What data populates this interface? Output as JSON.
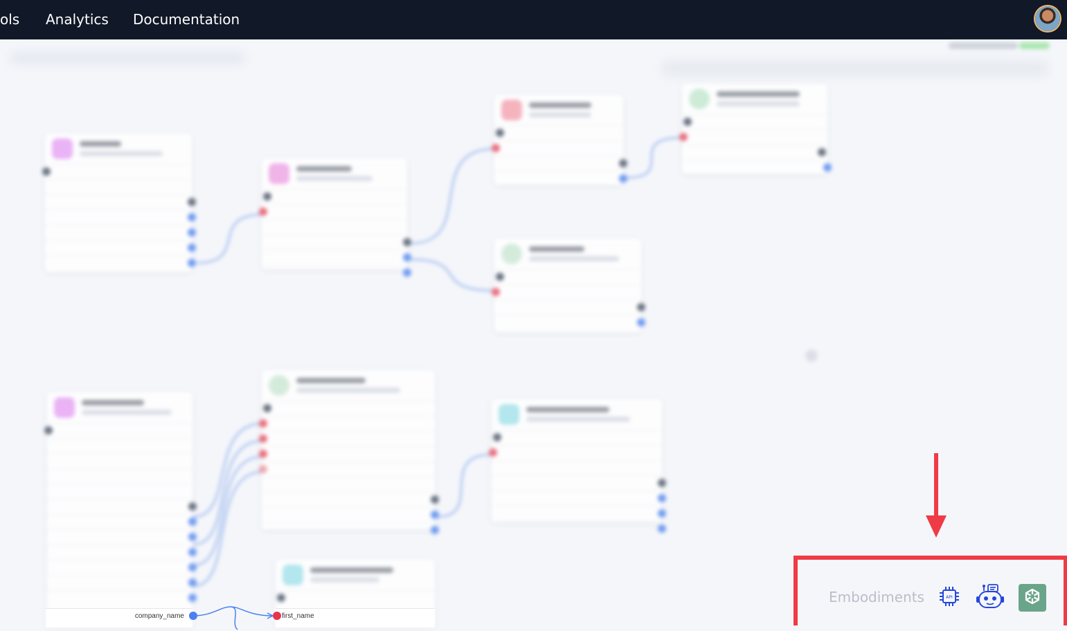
{
  "nav": {
    "items": [
      "ols",
      "Analytics",
      "Documentation"
    ]
  },
  "colors": {
    "topbar": "#111827",
    "canvas": "#f4f6fa",
    "highlight": "#ef3b45",
    "edge": "#5b8def",
    "port_red": "#e85a6a",
    "openai_badge": "#6aa589"
  },
  "canvas": {
    "visible_ports": {
      "output_label": "company_name",
      "input_label": "first_name"
    }
  },
  "embodiments": {
    "label": "Embodiments",
    "buttons": [
      {
        "name": "api-chip-icon",
        "text": "API"
      },
      {
        "name": "chatbot-icon"
      },
      {
        "name": "openai-icon"
      }
    ]
  }
}
